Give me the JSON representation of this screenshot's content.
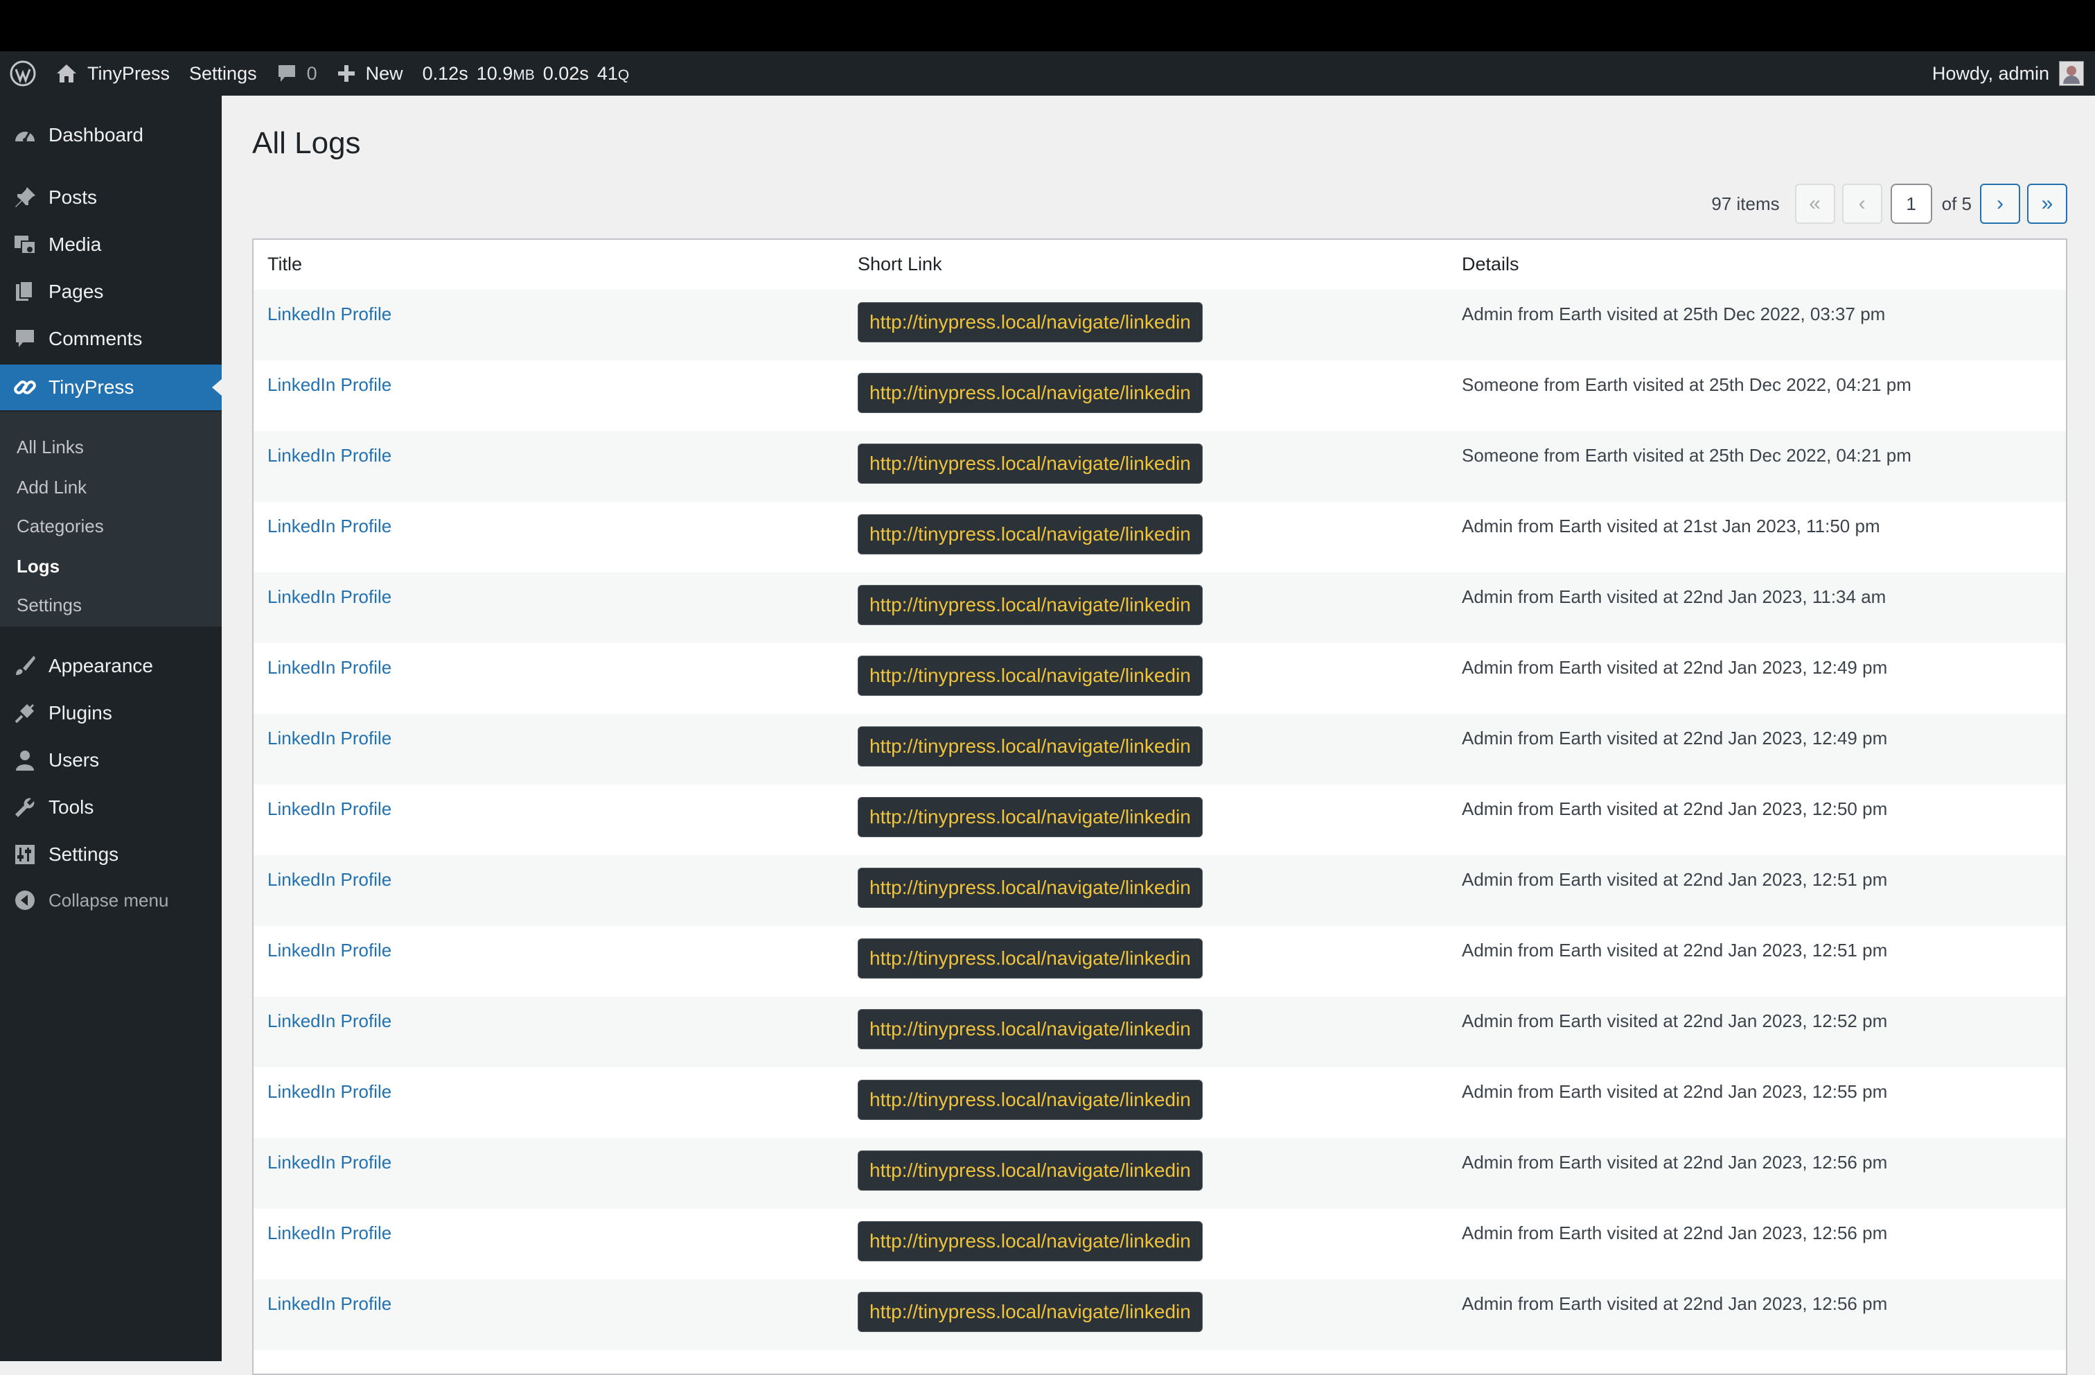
{
  "adminbar": {
    "site_name": "TinyPress",
    "settings": "Settings",
    "comments_count": "0",
    "new_label": "New",
    "perf_time": "0.12s",
    "perf_mem": "10.9",
    "perf_mem_unit": "MB",
    "perf_db": "0.02s",
    "perf_queries": "41",
    "perf_queries_unit": "Q",
    "howdy": "Howdy, admin"
  },
  "sidebar": {
    "dashboard": "Dashboard",
    "posts": "Posts",
    "media": "Media",
    "pages": "Pages",
    "comments": "Comments",
    "tinypress": "TinyPress",
    "sub": [
      "All Links",
      "Add Link",
      "Categories",
      "Logs",
      "Settings"
    ],
    "appearance": "Appearance",
    "plugins": "Plugins",
    "users": "Users",
    "tools": "Tools",
    "settings": "Settings",
    "collapse": "Collapse menu"
  },
  "page": {
    "title": "All Logs",
    "items_count": "97 items",
    "current_page": "1",
    "of_pages": "of 5"
  },
  "table": {
    "headers": [
      "Title",
      "Short Link",
      "Details"
    ],
    "rows": [
      {
        "title": "LinkedIn Profile",
        "link": "http://tinypress.local/navigate/linkedin",
        "details": "Admin from Earth visited at 25th Dec 2022, 03:37 pm"
      },
      {
        "title": "LinkedIn Profile",
        "link": "http://tinypress.local/navigate/linkedin",
        "details": "Someone from Earth visited at 25th Dec 2022, 04:21 pm"
      },
      {
        "title": "LinkedIn Profile",
        "link": "http://tinypress.local/navigate/linkedin",
        "details": "Someone from Earth visited at 25th Dec 2022, 04:21 pm"
      },
      {
        "title": "LinkedIn Profile",
        "link": "http://tinypress.local/navigate/linkedin",
        "details": "Admin from Earth visited at 21st Jan 2023, 11:50 pm"
      },
      {
        "title": "LinkedIn Profile",
        "link": "http://tinypress.local/navigate/linkedin",
        "details": "Admin from Earth visited at 22nd Jan 2023, 11:34 am"
      },
      {
        "title": "LinkedIn Profile",
        "link": "http://tinypress.local/navigate/linkedin",
        "details": "Admin from Earth visited at 22nd Jan 2023, 12:49 pm"
      },
      {
        "title": "LinkedIn Profile",
        "link": "http://tinypress.local/navigate/linkedin",
        "details": "Admin from Earth visited at 22nd Jan 2023, 12:49 pm"
      },
      {
        "title": "LinkedIn Profile",
        "link": "http://tinypress.local/navigate/linkedin",
        "details": "Admin from Earth visited at 22nd Jan 2023, 12:50 pm"
      },
      {
        "title": "LinkedIn Profile",
        "link": "http://tinypress.local/navigate/linkedin",
        "details": "Admin from Earth visited at 22nd Jan 2023, 12:51 pm"
      },
      {
        "title": "LinkedIn Profile",
        "link": "http://tinypress.local/navigate/linkedin",
        "details": "Admin from Earth visited at 22nd Jan 2023, 12:51 pm"
      },
      {
        "title": "LinkedIn Profile",
        "link": "http://tinypress.local/navigate/linkedin",
        "details": "Admin from Earth visited at 22nd Jan 2023, 12:52 pm"
      },
      {
        "title": "LinkedIn Profile",
        "link": "http://tinypress.local/navigate/linkedin",
        "details": "Admin from Earth visited at 22nd Jan 2023, 12:55 pm"
      },
      {
        "title": "LinkedIn Profile",
        "link": "http://tinypress.local/navigate/linkedin",
        "details": "Admin from Earth visited at 22nd Jan 2023, 12:56 pm"
      },
      {
        "title": "LinkedIn Profile",
        "link": "http://tinypress.local/navigate/linkedin",
        "details": "Admin from Earth visited at 22nd Jan 2023, 12:56 pm"
      },
      {
        "title": "LinkedIn Profile",
        "link": "http://tinypress.local/navigate/linkedin",
        "details": "Admin from Earth visited at 22nd Jan 2023, 12:56 pm"
      }
    ]
  },
  "colors": {
    "admin_bg": "#1d2327",
    "accent": "#2271b1",
    "shortlink_text": "#f0c33c"
  }
}
